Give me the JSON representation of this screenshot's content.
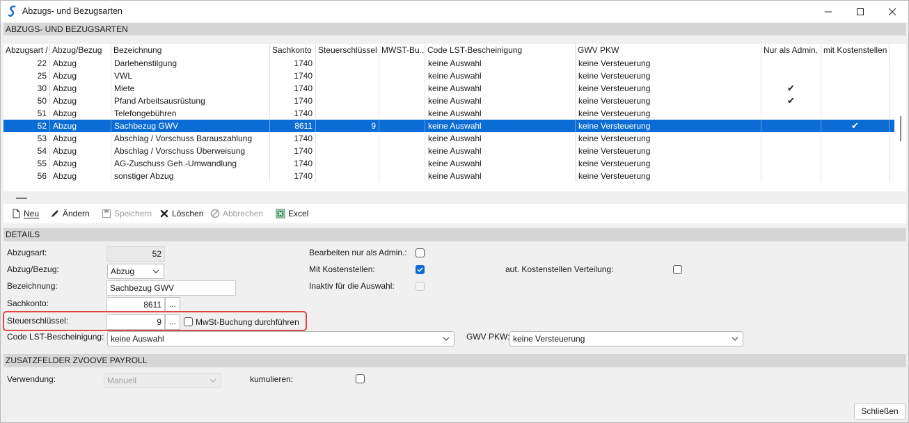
{
  "window": {
    "title": "Abzugs- und Bezugsarten"
  },
  "sections": {
    "list_header": "ABZUGS- UND BEZUGSARTEN",
    "details_header": "DETAILS",
    "extra_header": "ZUSATZFELDER ZVOOVE PAYROLL"
  },
  "grid": {
    "columns": [
      "Abzugsart",
      "Abzug/Bezug",
      "Bezeichnung",
      "Sachkonto",
      "Steuerschlüssel",
      "MWST-Bu...",
      "Code LST-Bescheinigung",
      "GWV PKW",
      "Nur als Admin.",
      "mit Kostenstellen"
    ],
    "sort_indicator": "/",
    "rows": [
      {
        "art": "22",
        "typ": "Abzug",
        "bez": "Darlehenstilgung",
        "konto": "1740",
        "steuer": "",
        "mwst": "",
        "code": "keine Auswahl",
        "gwv": "keine Versteuerung",
        "admin": false,
        "kst": false,
        "selected": false
      },
      {
        "art": "25",
        "typ": "Abzug",
        "bez": "VWL",
        "konto": "1740",
        "steuer": "",
        "mwst": "",
        "code": "keine Auswahl",
        "gwv": "keine Versteuerung",
        "admin": false,
        "kst": false,
        "selected": false
      },
      {
        "art": "30",
        "typ": "Abzug",
        "bez": "Miete",
        "konto": "1740",
        "steuer": "",
        "mwst": "",
        "code": "keine Auswahl",
        "gwv": "keine Versteuerung",
        "admin": true,
        "kst": false,
        "selected": false
      },
      {
        "art": "50",
        "typ": "Abzug",
        "bez": "Pfand Arbeitsausrüstung",
        "konto": "1740",
        "steuer": "",
        "mwst": "",
        "code": "keine Auswahl",
        "gwv": "keine Versteuerung",
        "admin": true,
        "kst": false,
        "selected": false
      },
      {
        "art": "51",
        "typ": "Abzug",
        "bez": "Telefongebühren",
        "konto": "1740",
        "steuer": "",
        "mwst": "",
        "code": "keine Auswahl",
        "gwv": "keine Versteuerung",
        "admin": false,
        "kst": false,
        "selected": false
      },
      {
        "art": "52",
        "typ": "Abzug",
        "bez": "Sachbezug GWV",
        "konto": "8611",
        "steuer": "9",
        "mwst": "",
        "code": "keine Auswahl",
        "gwv": "keine Versteuerung",
        "admin": false,
        "kst": true,
        "selected": true
      },
      {
        "art": "53",
        "typ": "Abzug",
        "bez": "Abschlag / Vorschuss Barauszahlung",
        "konto": "1740",
        "steuer": "",
        "mwst": "",
        "code": "keine Auswahl",
        "gwv": "keine Versteuerung",
        "admin": false,
        "kst": false,
        "selected": false
      },
      {
        "art": "54",
        "typ": "Abzug",
        "bez": "Abschlag / Vorschuss Überweisung",
        "konto": "1740",
        "steuer": "",
        "mwst": "",
        "code": "keine Auswahl",
        "gwv": "keine Versteuerung",
        "admin": false,
        "kst": false,
        "selected": false
      },
      {
        "art": "55",
        "typ": "Abzug",
        "bez": "AG-Zuschuss Geh.-Umwandlung",
        "konto": "1740",
        "steuer": "",
        "mwst": "",
        "code": "keine Auswahl",
        "gwv": "keine Versteuerung",
        "admin": false,
        "kst": false,
        "selected": false
      },
      {
        "art": "56",
        "typ": "Abzug",
        "bez": "sonstiger Abzug",
        "konto": "1740",
        "steuer": "",
        "mwst": "",
        "code": "keine Auswahl",
        "gwv": "keine Versteuerung",
        "admin": false,
        "kst": false,
        "selected": false
      }
    ]
  },
  "toolbar": {
    "neu": "Neu",
    "aendern": "Ändern",
    "speichern": "Speichern",
    "loeschen": "Löschen",
    "abbrechen": "Abbrechen",
    "excel": "Excel"
  },
  "details": {
    "abzugsart_label": "Abzugsart:",
    "abzugsart_value": "52",
    "abzug_bezug_label": "Abzug/Bezug:",
    "abzug_bezug_value": "Abzug",
    "bezeichnung_label": "Bezeichnung:",
    "bezeichnung_value": "Sachbezug GWV",
    "sachkonto_label": "Sachkonto:",
    "sachkonto_value": "8611",
    "steuerschluessel_label": "Steuerschlüssel:",
    "steuerschluessel_value": "9",
    "dots": "...",
    "mwst_label": "MwSt-Buchung durchführen",
    "code_lst_label": "Code LST-Bescheinigung:",
    "code_lst_value": "keine Auswahl",
    "gwv_label": "GWV PKW:",
    "gwv_value": "keine Versteuerung",
    "admin_label": "Bearbeiten nur als Admin.:",
    "kostenstellen_label": "Mit Kostenstellen:",
    "inaktiv_label": "Inaktiv für die Auswahl:",
    "aut_kst_label": "aut. Kostenstellen Verteilung:"
  },
  "extra": {
    "verwendung_label": "Verwendung:",
    "verwendung_value": "Manuell",
    "kumulieren_label": "kumulieren:"
  },
  "footer": {
    "close": "Schließen"
  },
  "colors": {
    "selection": "#0a6cd4",
    "highlight": "#e0454a",
    "section": "#d6d6d6"
  }
}
